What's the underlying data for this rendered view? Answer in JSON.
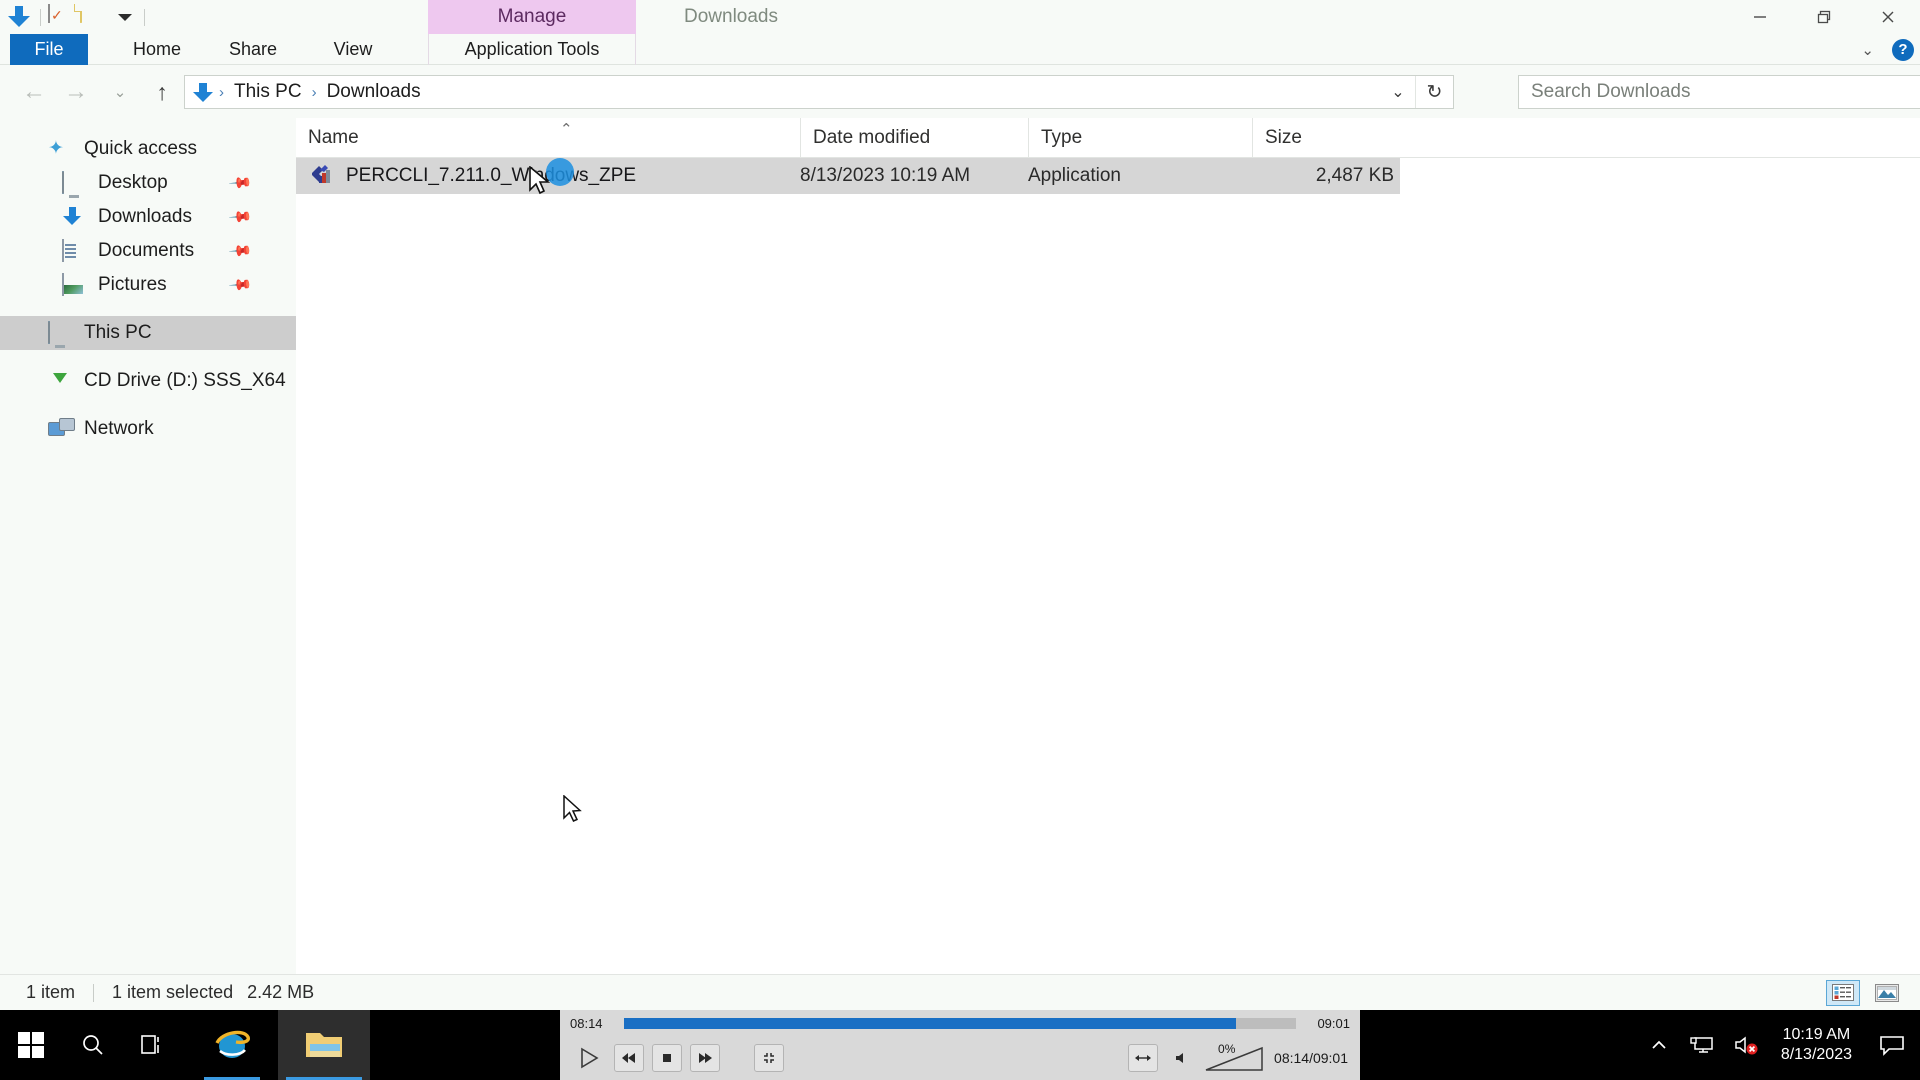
{
  "window": {
    "title": "Downloads",
    "contextual_tab_group": "Manage",
    "quick_access_toolbar": [
      {
        "name": "downloads-arrow",
        "icon": "download-arrow-icon"
      },
      {
        "name": "properties",
        "icon": "properties-checkmark-icon"
      },
      {
        "name": "new-folder",
        "icon": "folder-icon"
      },
      {
        "name": "customize",
        "icon": "caret-down-icon"
      }
    ],
    "controls": {
      "minimize": "Minimize",
      "maximize": "Restore Down",
      "close": "Close"
    },
    "ribbon_collapse": "Minimize the Ribbon",
    "help": "Help"
  },
  "ribbon": {
    "tabs": [
      {
        "label": "File",
        "active": true
      },
      {
        "label": "Home",
        "active": false
      },
      {
        "label": "Share",
        "active": false
      },
      {
        "label": "View",
        "active": false
      },
      {
        "label": "Application Tools",
        "active": false,
        "contextual": true
      }
    ]
  },
  "address_bar": {
    "back": "Back",
    "forward": "Forward",
    "recent_locations": "Recent locations",
    "up": "Up to This PC",
    "crumbs": [
      "This PC",
      "Downloads"
    ],
    "separator": "›",
    "dropdown": "Previous Locations",
    "refresh": "Refresh Downloads"
  },
  "search": {
    "placeholder": "Search Downloads",
    "value": "",
    "icon": "search-icon"
  },
  "nav_pane": {
    "items": [
      {
        "label": "Quick access",
        "icon": "star-icon",
        "indent": 0,
        "pinned": false,
        "selected": false
      },
      {
        "label": "Desktop",
        "icon": "monitor-icon",
        "indent": 1,
        "pinned": true,
        "selected": false
      },
      {
        "label": "Downloads",
        "icon": "download-arrow-icon",
        "indent": 1,
        "pinned": true,
        "selected": false
      },
      {
        "label": "Documents",
        "icon": "document-icon",
        "indent": 1,
        "pinned": true,
        "selected": false
      },
      {
        "label": "Pictures",
        "icon": "picture-icon",
        "indent": 1,
        "pinned": true,
        "selected": false
      },
      {
        "label": "This PC",
        "icon": "monitor-icon",
        "indent": 0,
        "pinned": false,
        "selected": true
      },
      {
        "label": "CD Drive (D:) SSS_X64",
        "icon": "cd-drive-icon",
        "indent": 0,
        "pinned": false,
        "selected": false
      },
      {
        "label": "Network",
        "icon": "network-icon",
        "indent": 0,
        "pinned": false,
        "selected": false
      }
    ]
  },
  "file_list": {
    "columns": [
      "Name",
      "Date modified",
      "Type",
      "Size"
    ],
    "sorted_by": "Name",
    "sort_direction": "ascending",
    "rows": [
      {
        "name": "PERCCLI_7.211.0_Windows_ZPE",
        "date_modified": "8/13/2023 10:19 AM",
        "type": "Application",
        "size": "2,487 KB",
        "selected": true,
        "icon": "application-icon"
      }
    ]
  },
  "status_bar": {
    "item_count": "1 item",
    "selection": "1 item selected",
    "selection_size": "2.42 MB",
    "views": [
      {
        "name": "details-view",
        "active": true
      },
      {
        "name": "large-icons-view",
        "active": false
      }
    ]
  },
  "media_player": {
    "elapsed": "08:14",
    "duration": "09:01",
    "position_label": "08:14/09:01",
    "progress_percent": 91,
    "volume_percent": "0%",
    "controls": [
      {
        "name": "play-button",
        "glyph": "▶"
      },
      {
        "name": "previous-button",
        "glyph": "◄◄"
      },
      {
        "name": "stop-button",
        "glyph": "■"
      },
      {
        "name": "next-button",
        "glyph": "►►"
      },
      {
        "name": "fullscreen-button",
        "glyph": "⤡"
      },
      {
        "name": "aspect-ratio-button",
        "glyph": "↔"
      },
      {
        "name": "mute-button",
        "glyph": "🔈"
      }
    ]
  },
  "taskbar": {
    "buttons": [
      {
        "name": "start-button",
        "icon": "windows-logo-icon"
      },
      {
        "name": "search-button",
        "icon": "search-icon"
      },
      {
        "name": "task-view-button",
        "icon": "task-view-icon"
      },
      {
        "name": "internet-explorer-button",
        "icon": "internet-explorer-icon"
      },
      {
        "name": "file-explorer-button",
        "icon": "file-explorer-icon"
      }
    ],
    "tray": {
      "show_hidden": "Show hidden icons",
      "network_icon": "network-icon",
      "volume_icon": "volume-muted-icon",
      "time": "10:19 AM",
      "date": "8/13/2023",
      "action_center": "action-center-icon"
    }
  }
}
